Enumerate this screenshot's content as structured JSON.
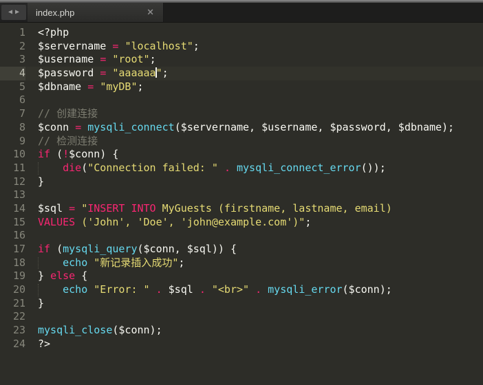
{
  "window": {
    "tab_title": "index.php",
    "close_icon": "×",
    "nav_back_icon": "◀",
    "nav_forward_icon": "▶"
  },
  "colors": {
    "bg": "#2d2d28",
    "fg": "#f8f8f2",
    "pink": "#f92672",
    "yellow": "#e6db74",
    "cyan": "#66d9ef",
    "comment": "#7c7c70"
  },
  "editor": {
    "language": "php",
    "current_line": 4,
    "lines": [
      {
        "n": 1,
        "tokens": [
          {
            "t": "<?php",
            "c": "fg"
          }
        ]
      },
      {
        "n": 2,
        "tokens": [
          {
            "t": "$servername ",
            "c": "fg"
          },
          {
            "t": "=",
            "c": "pink"
          },
          {
            "t": " ",
            "c": "fg"
          },
          {
            "t": "\"localhost\"",
            "c": "yellow"
          },
          {
            "t": ";",
            "c": "fg"
          }
        ]
      },
      {
        "n": 3,
        "tokens": [
          {
            "t": "$username ",
            "c": "fg"
          },
          {
            "t": "=",
            "c": "pink"
          },
          {
            "t": " ",
            "c": "fg"
          },
          {
            "t": "\"root\"",
            "c": "yellow"
          },
          {
            "t": ";",
            "c": "fg"
          }
        ]
      },
      {
        "n": 4,
        "tokens": [
          {
            "t": "$password ",
            "c": "fg"
          },
          {
            "t": "=",
            "c": "pink"
          },
          {
            "t": " ",
            "c": "fg"
          },
          {
            "t": "\"aaaaaa",
            "c": "yellow"
          },
          {
            "t": "",
            "c": "cursor"
          },
          {
            "t": "\"",
            "c": "yellow"
          },
          {
            "t": ";",
            "c": "fg"
          }
        ]
      },
      {
        "n": 5,
        "tokens": [
          {
            "t": "$dbname ",
            "c": "fg"
          },
          {
            "t": "=",
            "c": "pink"
          },
          {
            "t": " ",
            "c": "fg"
          },
          {
            "t": "\"myDB\"",
            "c": "yellow"
          },
          {
            "t": ";",
            "c": "fg"
          }
        ]
      },
      {
        "n": 6,
        "tokens": []
      },
      {
        "n": 7,
        "tokens": [
          {
            "t": "// 创建连接",
            "c": "comment"
          }
        ]
      },
      {
        "n": 8,
        "tokens": [
          {
            "t": "$conn ",
            "c": "fg"
          },
          {
            "t": "=",
            "c": "pink"
          },
          {
            "t": " ",
            "c": "fg"
          },
          {
            "t": "mysqli_connect",
            "c": "cyan"
          },
          {
            "t": "($servername, $username, $password, $dbname);",
            "c": "fg"
          }
        ]
      },
      {
        "n": 9,
        "tokens": [
          {
            "t": "// 检测连接",
            "c": "comment"
          }
        ]
      },
      {
        "n": 10,
        "tokens": [
          {
            "t": "if",
            "c": "pink"
          },
          {
            "t": " (",
            "c": "fg"
          },
          {
            "t": "!",
            "c": "pink"
          },
          {
            "t": "$conn) {",
            "c": "fg"
          }
        ]
      },
      {
        "n": 11,
        "guide": true,
        "tokens": [
          {
            "t": "    ",
            "c": "fg"
          },
          {
            "t": "die",
            "c": "pink"
          },
          {
            "t": "(",
            "c": "fg"
          },
          {
            "t": "\"Connection failed: \"",
            "c": "yellow"
          },
          {
            "t": " ",
            "c": "fg"
          },
          {
            "t": ".",
            "c": "pink"
          },
          {
            "t": " ",
            "c": "fg"
          },
          {
            "t": "mysqli_connect_error",
            "c": "cyan"
          },
          {
            "t": "());",
            "c": "fg"
          }
        ]
      },
      {
        "n": 12,
        "tokens": [
          {
            "t": "}",
            "c": "fg"
          }
        ]
      },
      {
        "n": 13,
        "tokens": []
      },
      {
        "n": 14,
        "tokens": [
          {
            "t": "$sql ",
            "c": "fg"
          },
          {
            "t": "=",
            "c": "pink"
          },
          {
            "t": " ",
            "c": "fg"
          },
          {
            "t": "\"",
            "c": "yellow"
          },
          {
            "t": "INSERT INTO",
            "c": "pink"
          },
          {
            "t": " MyGuests (firstname, lastname, email)",
            "c": "yellow"
          }
        ]
      },
      {
        "n": 15,
        "tokens": [
          {
            "t": "VALUES",
            "c": "pink"
          },
          {
            "t": " ('John', 'Doe', 'john@example.com')\"",
            "c": "yellow"
          },
          {
            "t": ";",
            "c": "fg"
          }
        ]
      },
      {
        "n": 16,
        "tokens": []
      },
      {
        "n": 17,
        "tokens": [
          {
            "t": "if",
            "c": "pink"
          },
          {
            "t": " (",
            "c": "fg"
          },
          {
            "t": "mysqli_query",
            "c": "cyan"
          },
          {
            "t": "($conn, $sql)) {",
            "c": "fg"
          }
        ]
      },
      {
        "n": 18,
        "guide": true,
        "tokens": [
          {
            "t": "    ",
            "c": "fg"
          },
          {
            "t": "echo",
            "c": "cyan"
          },
          {
            "t": " ",
            "c": "fg"
          },
          {
            "t": "\"新记录插入成功\"",
            "c": "yellow"
          },
          {
            "t": ";",
            "c": "fg"
          }
        ]
      },
      {
        "n": 19,
        "tokens": [
          {
            "t": "} ",
            "c": "fg"
          },
          {
            "t": "else",
            "c": "pink"
          },
          {
            "t": " {",
            "c": "fg"
          }
        ]
      },
      {
        "n": 20,
        "guide": true,
        "tokens": [
          {
            "t": "    ",
            "c": "fg"
          },
          {
            "t": "echo",
            "c": "cyan"
          },
          {
            "t": " ",
            "c": "fg"
          },
          {
            "t": "\"Error: \"",
            "c": "yellow"
          },
          {
            "t": " ",
            "c": "fg"
          },
          {
            "t": ".",
            "c": "pink"
          },
          {
            "t": " ",
            "c": "fg"
          },
          {
            "t": "$sql",
            "c": "fg"
          },
          {
            "t": " ",
            "c": "fg"
          },
          {
            "t": ".",
            "c": "pink"
          },
          {
            "t": " ",
            "c": "fg"
          },
          {
            "t": "\"<br>\"",
            "c": "yellow"
          },
          {
            "t": " ",
            "c": "fg"
          },
          {
            "t": ".",
            "c": "pink"
          },
          {
            "t": " ",
            "c": "fg"
          },
          {
            "t": "mysqli_error",
            "c": "cyan"
          },
          {
            "t": "($conn);",
            "c": "fg"
          }
        ]
      },
      {
        "n": 21,
        "tokens": [
          {
            "t": "}",
            "c": "fg"
          }
        ]
      },
      {
        "n": 22,
        "tokens": []
      },
      {
        "n": 23,
        "tokens": [
          {
            "t": "mysqli_close",
            "c": "cyan"
          },
          {
            "t": "($conn);",
            "c": "fg"
          }
        ]
      },
      {
        "n": 24,
        "tokens": [
          {
            "t": "?>",
            "c": "fg"
          }
        ]
      }
    ]
  }
}
